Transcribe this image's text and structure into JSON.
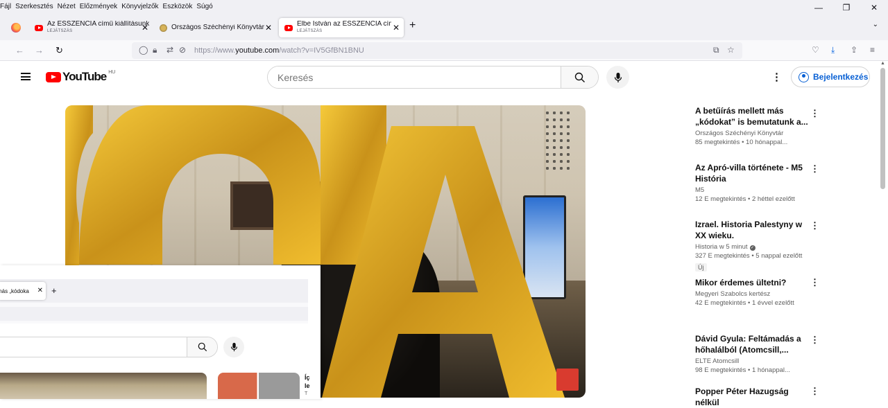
{
  "menubar": {
    "items": [
      "Fájl",
      "Szerkesztés",
      "Nézet",
      "Előzmények",
      "Könyvjelzők",
      "Eszközök",
      "Súgó"
    ]
  },
  "window_controls": {
    "minimize": "—",
    "restore": "❐",
    "close": "✕"
  },
  "tabs": [
    {
      "title": "Az ESSZENCIA című kiállításunk",
      "subtitle": "LEJÁTSZÁS",
      "close": "✕"
    },
    {
      "title": "Országos Széchényi Könyvtár",
      "subtitle": "",
      "close": "✕"
    },
    {
      "title": "Elbe István az ESSZENCIA című",
      "subtitle": "LEJÁTSZÁS",
      "close": "✕"
    }
  ],
  "tab_new": "+",
  "tab_list": "⌄",
  "nav": {
    "back": "←",
    "forward": "→",
    "reload": "↻",
    "url_prefix": "https://www.",
    "url_domain": "youtube.com",
    "url_rest": "/watch?v=IV5GfBN1BNU"
  },
  "youtube": {
    "logo_text": "YouTube",
    "country_code": "HU",
    "search_placeholder": "Keresés",
    "sign_in": "Bejelentkezés",
    "more": "⋮"
  },
  "overlay": {
    "tab_title": "más „kódoka",
    "tab_close": "✕",
    "tab_new": "+",
    "title_line1": "Íç",
    "title_line2": "le",
    "title_line3": "T"
  },
  "recommendations": [
    {
      "title": "A betűírás mellett más „kódokat” is bemutatunk a...",
      "channel": "Országos Széchényi Könyvtár",
      "meta": "85 megtekintés • 10 hónappal...",
      "verified": false,
      "badge": ""
    },
    {
      "title": "Az Apró-villa története - M5 História",
      "channel": "M5",
      "meta": "12 E megtekintés • 2 héttel ezelőtt",
      "verified": false,
      "badge": ""
    },
    {
      "title": "Izrael. Historia Palestyny w XX wieku.",
      "channel": "Historia w 5 minut",
      "meta": "327 E megtekintés • 5 nappal ezelőtt",
      "verified": true,
      "badge": "Új"
    },
    {
      "title": "Mikor érdemes ültetni?",
      "channel": "Megyeri Szabolcs kertész",
      "meta": "42 E megtekintés • 1 évvel ezelőtt",
      "verified": false,
      "badge": ""
    },
    {
      "title": "Dávid Gyula: Feltámadás a hőhalálból (Atomcsill,...",
      "channel": "ELTE Atomcsill",
      "meta": "98 E megtekintés • 1 hónappal...",
      "verified": false,
      "badge": ""
    },
    {
      "title": "Popper Péter Hazugság nélkül",
      "channel": "",
      "meta": "",
      "verified": false,
      "badge": ""
    }
  ],
  "colors": {
    "yt_red": "#ff0000",
    "link_blue": "#065fd4",
    "gold": "#d8a425"
  }
}
